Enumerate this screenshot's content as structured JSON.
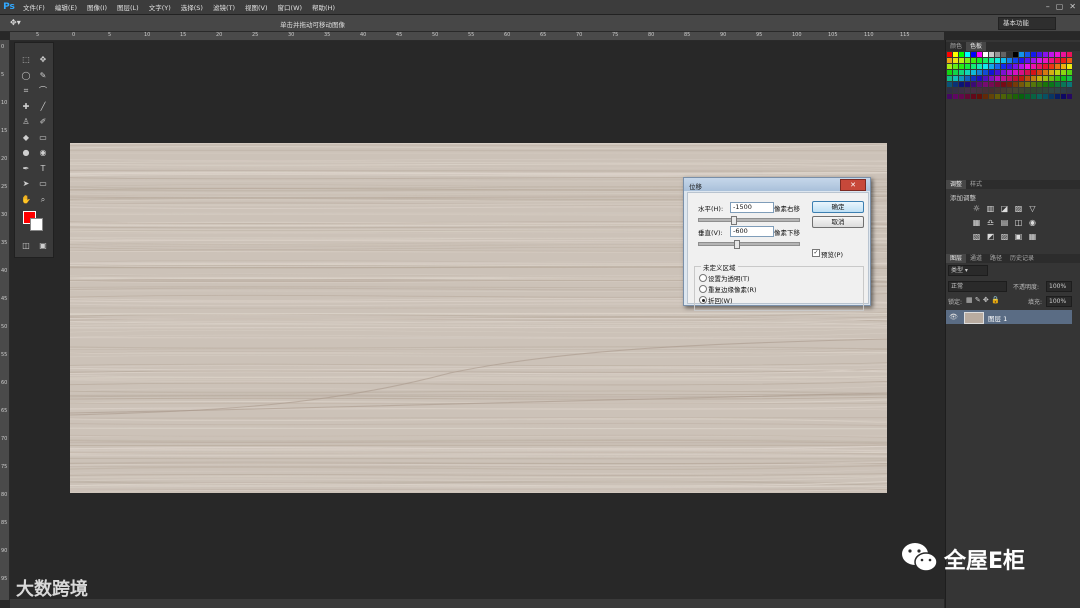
{
  "app": {
    "logo": "Ps"
  },
  "menu": [
    "文件(F)",
    "编辑(E)",
    "图像(I)",
    "图层(L)",
    "文字(Y)",
    "选择(S)",
    "滤镜(T)",
    "视图(V)",
    "窗口(W)",
    "帮助(H)"
  ],
  "window_controls": [
    "–",
    "▢",
    "✕"
  ],
  "options_bar": {
    "tool_icon": "move-tool",
    "hint": "单击并拖动可移动图像",
    "workspace": "基本功能"
  },
  "ruler_top_labels": [
    "5",
    "0",
    "5",
    "10",
    "15",
    "20",
    "25",
    "30",
    "35",
    "40",
    "45",
    "50",
    "55",
    "60",
    "65",
    "70",
    "75",
    "80",
    "85",
    "90",
    "95",
    "100",
    "105",
    "110",
    "115"
  ],
  "ruler_left_labels": [
    "0",
    "5",
    "10",
    "15",
    "20",
    "25",
    "30",
    "35",
    "40",
    "45",
    "50",
    "55",
    "60",
    "65",
    "70",
    "75",
    "80",
    "85",
    "90",
    "95"
  ],
  "tools": [
    "marquee",
    "move",
    "lasso",
    "quick-select",
    "crop",
    "eyedropper",
    "healing",
    "brush",
    "stamp",
    "history-brush",
    "eraser",
    "gradient",
    "blur",
    "dodge",
    "pen",
    "type",
    "path-select",
    "shape",
    "hand",
    "zoom"
  ],
  "colors": {
    "foreground": "#ff0000",
    "background": "#ffffff",
    "accent": "#31a8ff"
  },
  "panels": {
    "swatch_tabs": [
      "颜色",
      "色板"
    ],
    "adjust_tabs": [
      "调整",
      "样式"
    ],
    "adjust_title": "添加调整",
    "layer_tabs": [
      "图层",
      "通道",
      "路径",
      "历史记录"
    ],
    "kind_filter": "类型",
    "blend_mode": "正常",
    "opacity_label": "不透明度:",
    "opacity_value": "100%",
    "lock_label": "锁定:",
    "fill_label": "填充:",
    "fill_value": "100%",
    "layer_name": "图层 1"
  },
  "dialog": {
    "title": "位移",
    "horizontal_label": "水平(H):",
    "horizontal_value": "-1500",
    "horizontal_unit": "像素右移",
    "horizontal_slider": 0.33,
    "vertical_label": "垂直(V):",
    "vertical_value": "-600",
    "vertical_unit": "像素下移",
    "vertical_slider": 0.36,
    "ok": "确定",
    "cancel": "取消",
    "preview_label": "预览(P)",
    "preview_checked": true,
    "group_title": "未定义区域",
    "options": [
      "设置为透明(T)",
      "重复边缘像素(R)",
      "折回(W)"
    ],
    "selected_option": 2,
    "close": "✕"
  },
  "watermarks": {
    "left": "大数跨境",
    "right": "全屋E柜"
  }
}
